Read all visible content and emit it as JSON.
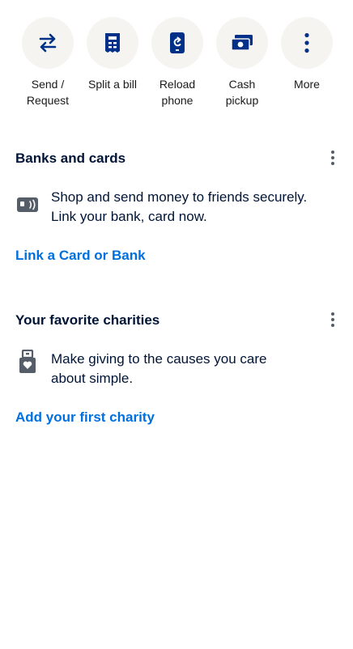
{
  "quick_actions": [
    {
      "label": "Send /\nRequest",
      "icon": "transfer-arrows-icon"
    },
    {
      "label": "Split a bill",
      "icon": "receipt-icon"
    },
    {
      "label": "Reload\nphone",
      "icon": "phone-reload-icon"
    },
    {
      "label": "Cash\npickup",
      "icon": "cash-icon"
    },
    {
      "label": "More",
      "icon": "more-vertical-icon"
    }
  ],
  "banks": {
    "title": "Banks and cards",
    "description": "Shop and send money to friends securely.\nLink your bank, card now.",
    "link": "Link a Card or Bank"
  },
  "charities": {
    "title": "Your favorite charities",
    "description": "Make giving to the causes you care\nabout simple.",
    "link": "Add your first charity"
  },
  "colors": {
    "primary": "#003087",
    "link": "#0070e0",
    "text": "#001435",
    "chip": "#f5f4f1"
  }
}
